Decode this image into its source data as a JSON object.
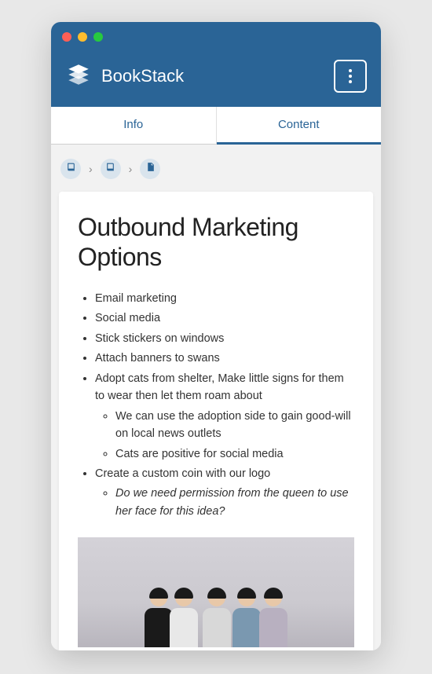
{
  "app": {
    "name": "BookStack"
  },
  "tabs": {
    "info": "Info",
    "content": "Content"
  },
  "page": {
    "title": "Outbound Marketing Options",
    "bullets": [
      "Email marketing",
      "Social media",
      "Stick stickers on windows",
      "Attach banners to swans",
      "Adopt cats from shelter, Make little signs for them to wear then let them roam about",
      "Create a custom coin with our logo"
    ],
    "sub_cats": [
      "We can use the adoption side to gain good-will on local news outlets",
      "Cats are positive for social media"
    ],
    "sub_coin": [
      "Do we need permission from the queen to use her face for this idea?"
    ]
  }
}
